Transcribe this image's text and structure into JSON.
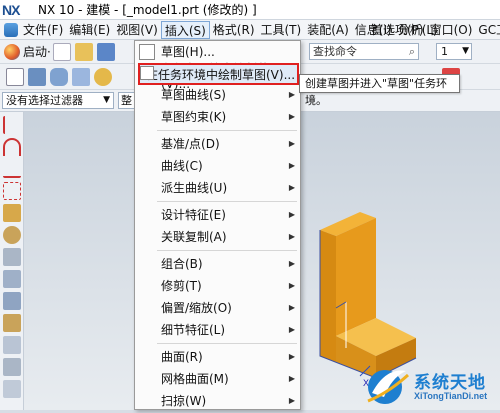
{
  "titlebar": {
    "logo": "NX",
    "title": "NX 10 - 建模 - [_model1.prt  (修改的) ]"
  },
  "menubar": {
    "items": [
      "文件(F)",
      "编辑(E)",
      "视图(V)",
      "插入(S)",
      "格式(R)",
      "工具(T)",
      "装配(A)",
      "信息(I)",
      "分析(L)"
    ],
    "right_items": [
      "首选项(P)",
      "窗口(O)",
      "GC工具"
    ]
  },
  "toolbar": {
    "start_label": "启动·",
    "search_placeholder": "查找命令",
    "number_value": "1"
  },
  "filter": {
    "value": "没有选择过滤器",
    "whole_label": "整"
  },
  "gc_label": "GC",
  "submenu": {
    "items": [
      {
        "label": "草图(H)...",
        "arrow": ""
      },
      {
        "label": "在任务环境中绘制草图(V)...",
        "arrow": ""
      },
      {
        "label": "草图曲线(S)",
        "arrow": "▶"
      },
      {
        "label": "草图约束(K)",
        "arrow": "▶"
      },
      {
        "label": "基准/点(D)",
        "arrow": "▶"
      },
      {
        "label": "曲线(C)",
        "arrow": "▶"
      },
      {
        "label": "派生曲线(U)",
        "arrow": "▶"
      },
      {
        "label": "设计特征(E)",
        "arrow": "▶"
      },
      {
        "label": "关联复制(A)",
        "arrow": "▶"
      },
      {
        "label": "组合(B)",
        "arrow": "▶"
      },
      {
        "label": "修剪(T)",
        "arrow": "▶"
      },
      {
        "label": "偏置/缩放(O)",
        "arrow": "▶"
      },
      {
        "label": "细节特征(L)",
        "arrow": "▶"
      },
      {
        "label": "曲面(R)",
        "arrow": "▶"
      },
      {
        "label": "网格曲面(M)",
        "arrow": "▶"
      },
      {
        "label": "扫掠(W)",
        "arrow": "▶"
      }
    ]
  },
  "tooltip": "创建草图并进入\"草图\"任务环境。",
  "watermark": {
    "title": "系统天地",
    "url": "XiTongTianDi.net"
  },
  "axis_label": "X",
  "colors": {
    "accent": "#e02020",
    "part": "#f0a020",
    "watermark": "#1e7fd0"
  }
}
